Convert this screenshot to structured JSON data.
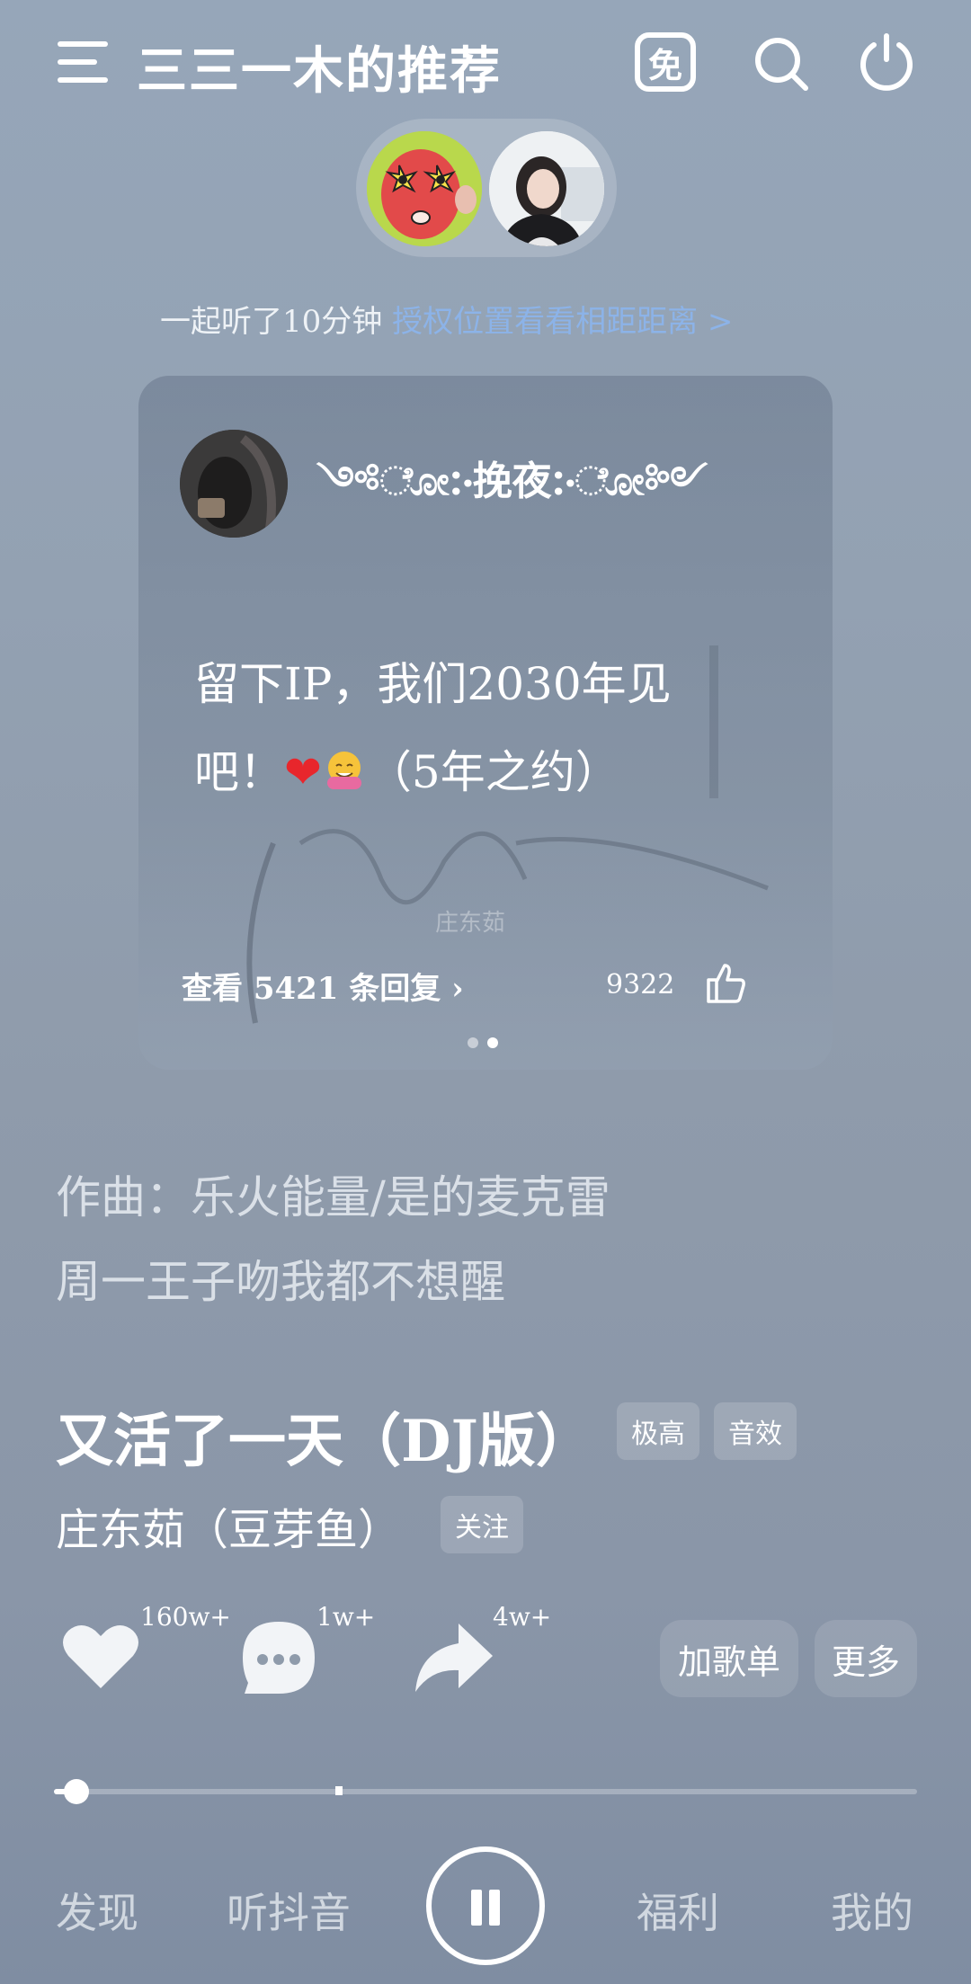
{
  "header": {
    "title": "三三一木的推荐",
    "free_label": "免",
    "icons": [
      "menu-icon",
      "free-icon",
      "search-icon",
      "power-icon"
    ]
  },
  "listen": {
    "prefix": "一起听了10分钟",
    "link": "授权位置看看相距距离 >"
  },
  "comment_card": {
    "username": "༺ೋ჻挽夜჻ೋ༻",
    "text_line1": "留下IP，我们2030年见",
    "text_line2_a": "吧！",
    "text_line2_heart": "❤",
    "text_line2_b": "（5年之约）",
    "watermark_name": "庄东茹",
    "view_replies": "查看 5421 条回复 ›",
    "like_count": "9322",
    "page_index": 2,
    "page_count": 2
  },
  "lyrics": [
    "作曲：乐火能量/是的麦克雷",
    "周一王子吻我都不想醒"
  ],
  "song": {
    "title": "又活了一天（DJ版）",
    "tags": [
      "极高",
      "音效"
    ],
    "artist": "庄东茹（豆芽鱼）",
    "follow": "关注"
  },
  "actions": {
    "like_count": "160w+",
    "comment_count": "1w+",
    "share_count": "4w+",
    "add_playlist": "加歌单",
    "more": "更多"
  },
  "progress": {
    "played_fraction": 0.02,
    "buffered_fraction": 0.33
  },
  "nav": {
    "discover": "发现",
    "listen_douyin": "听抖音",
    "welfare": "福利",
    "mine": "我的"
  },
  "colors": {
    "link": "#8cb3e8",
    "heart": "#e8262c"
  }
}
